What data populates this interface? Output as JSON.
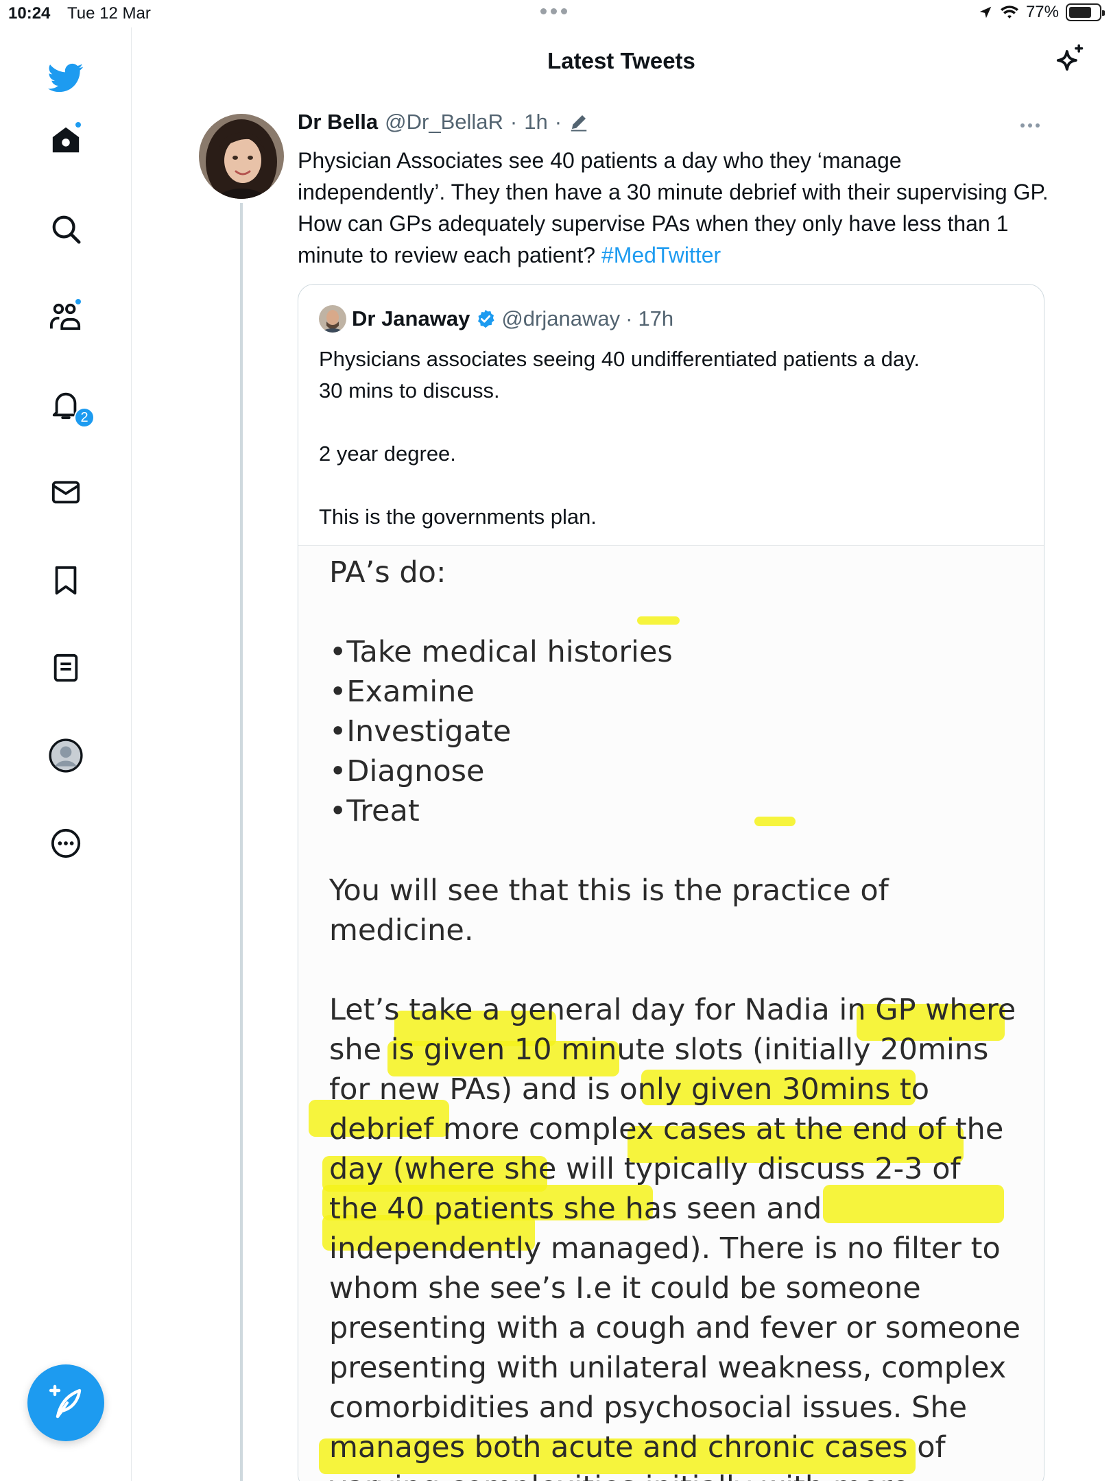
{
  "status_bar": {
    "time": "10:24",
    "date": "Tue 12 Mar",
    "battery": "77%",
    "battery_level": 0.77
  },
  "sidebar": {
    "items": [
      {
        "name": "home",
        "icon": "home-icon",
        "has_dot": true
      },
      {
        "name": "explore",
        "icon": "search-icon",
        "has_dot": false
      },
      {
        "name": "communities",
        "icon": "communities-icon",
        "has_dot": true
      },
      {
        "name": "notifications",
        "icon": "bell-icon",
        "badge": "2"
      },
      {
        "name": "messages",
        "icon": "envelope-icon",
        "has_dot": false
      },
      {
        "name": "bookmarks",
        "icon": "bookmark-icon",
        "has_dot": false
      },
      {
        "name": "lists",
        "icon": "lists-icon",
        "has_dot": false
      },
      {
        "name": "profile",
        "icon": "avatar-icon",
        "has_dot": false
      },
      {
        "name": "more",
        "icon": "more-circle-icon",
        "has_dot": false
      }
    ],
    "compose_icon": "compose-tweet-icon"
  },
  "header": {
    "title": "Latest Tweets",
    "sparkle_icon": "sparkle-icon"
  },
  "tweet": {
    "name": "Dr Bella",
    "handle": "@Dr_BellaR",
    "separator": "·",
    "time": "1h",
    "edited_icon": "pencil-icon",
    "text": "Physician Associates see 40 patients a day who they ‘manage independently’. They then have a 30 minute debrief with their supervising GP. How can GPs adequately supervise PAs when they only have less than 1 minute to review each patient? ",
    "hashtag": "#MedTwitter",
    "quote": {
      "name": "Dr Janaway",
      "verified_icon": "verified-badge-icon",
      "handle": "@drjanaway",
      "separator": "·",
      "time": "17h",
      "lines": [
        "Physicians associates seeing 40 undifferentiated patients a day.",
        "30 mins to discuss.",
        "",
        "2 year degree.",
        "",
        "This is the governments plan."
      ],
      "image_text": {
        "heading": "PA’s do:",
        "bullets": [
          "•Take medical histories",
          "•Examine",
          "•Investigate",
          "•Diagnose",
          "•Treat"
        ],
        "para1": [
          "You will see that this is the practice of",
          "medicine."
        ],
        "para2": [
          "Let’s take a general day for Nadia in GP where",
          "she is given 10 minute slots (initially 20mins",
          "for new PAs) and is only given 30mins to",
          "debrief more complex cases at the end of the",
          "day (where she will typically discuss 2-3 of",
          "the 40 patients she has seen and",
          "independently managed). There is no filter to",
          "whom she see’s I.e it could be someone",
          "presenting with a cough and fever or someone",
          "presenting with unilateral weakness, complex",
          "comorbidities and psychosocial issues. She",
          "manages both acute and chronic cases of",
          "varying complexities initially with more"
        ]
      },
      "highlight_color": "#f4f21b"
    }
  }
}
